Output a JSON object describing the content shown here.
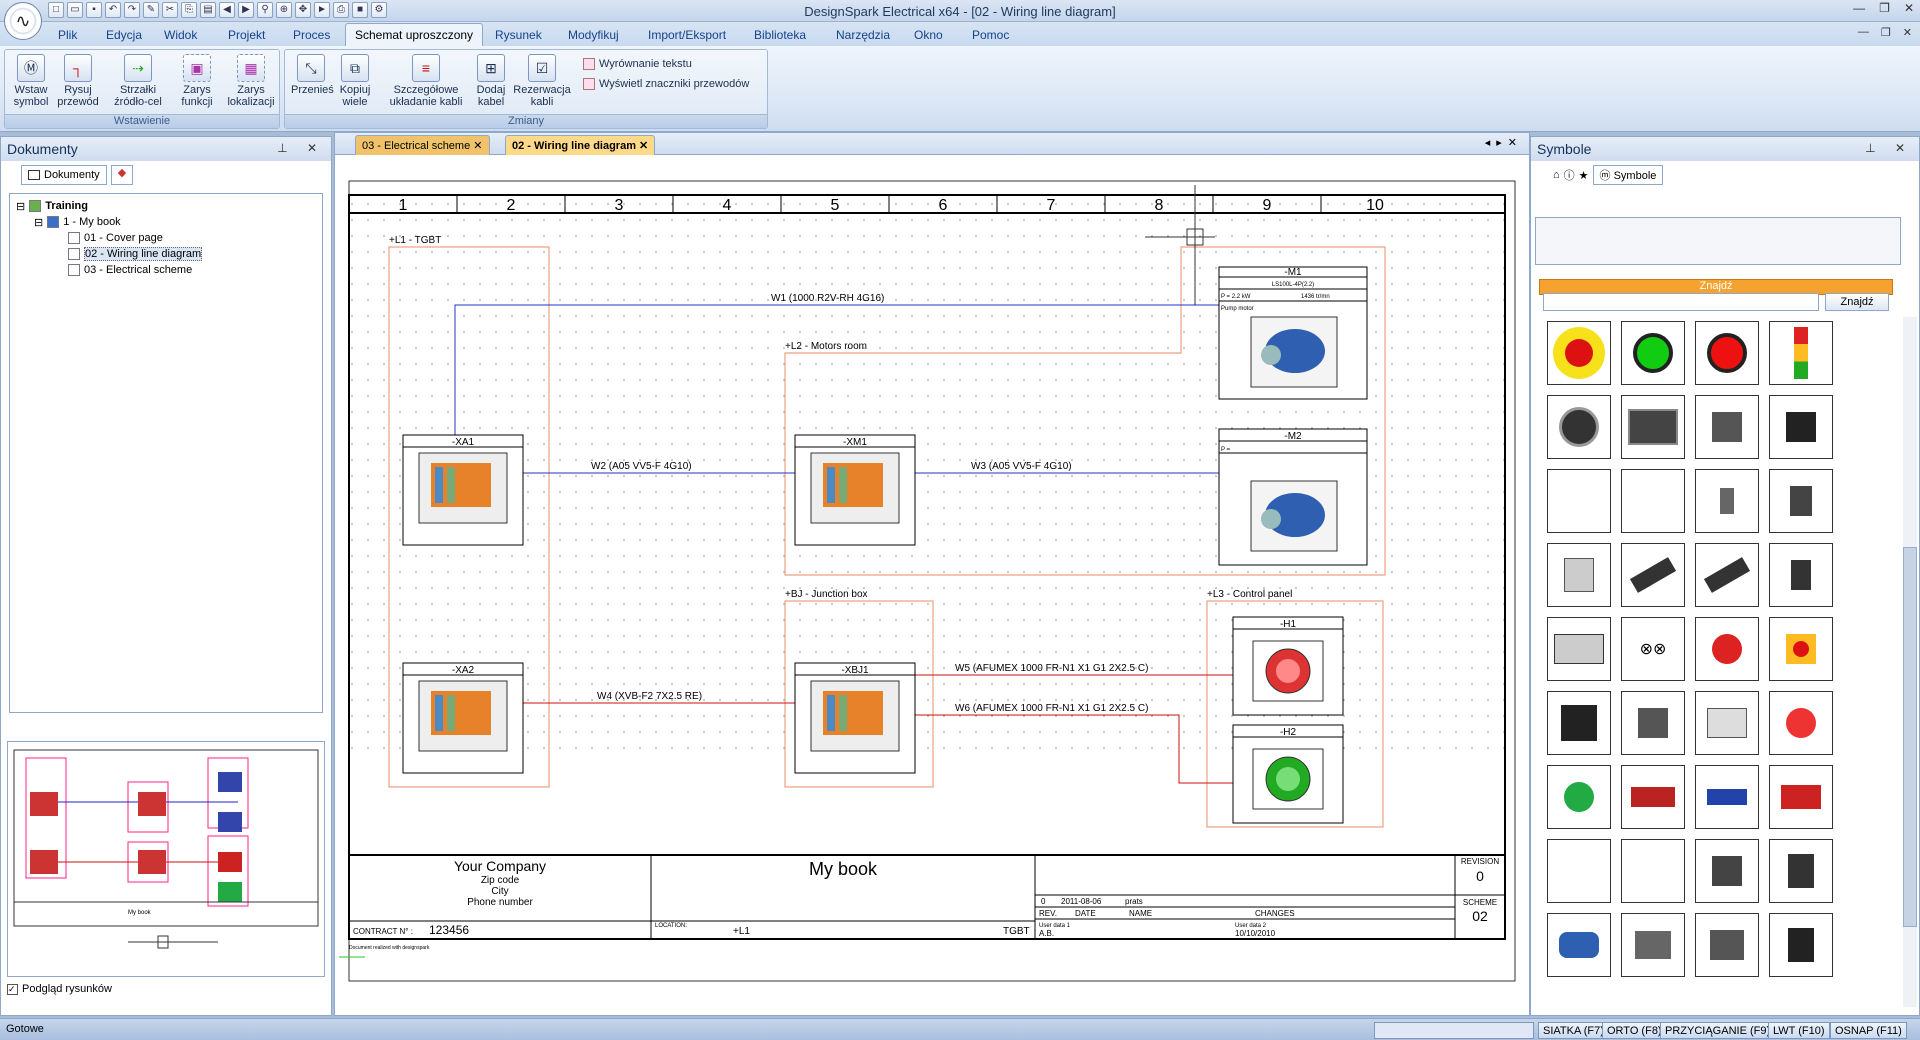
{
  "window": {
    "title": "DesignSpark Electrical x64 - [02 - Wiring line diagram]",
    "logo_glyph": "∿"
  },
  "menu": [
    "Plik",
    "Edycja",
    "Widok",
    "Projekt",
    "Proces",
    "Schemat uproszczony",
    "Rysunek",
    "Modyfikuj",
    "Import/Eksport",
    "Biblioteka",
    "Narzędzia",
    "Okno",
    "Pomoc"
  ],
  "ribbon": {
    "insert_group": "Wstawienie",
    "changes_group": "Zmiany",
    "buttons": {
      "insert_symbol": "Wstaw symbol",
      "draw_wire": "Rysuj przewód",
      "arrows": "Strzałki źródło-cel",
      "function_outline": "Zarys funkcji",
      "location_outline": "Zarys lokalizacji",
      "move": "Przenieś",
      "copy_many": "Kopiuj wiele",
      "cable_layout": "Szczegółowe układanie kabli",
      "add_cable": "Dodaj kabel",
      "cable_reservation": "Rezerwacja kabli",
      "align_text": "Wyrównanie tekstu",
      "show_wire_markers": "Wyświetl znaczniki przewodów"
    }
  },
  "documents_panel": {
    "title": "Dokumenty",
    "tab": "Dokumenty",
    "tree": {
      "root": "Training",
      "book": "1 - My book",
      "pages": [
        "01 - Cover page",
        "02 - Wiring line diagram",
        "03 - Electrical scheme"
      ]
    },
    "preview_checkbox": "Podgląd rysunków",
    "preview_book_label": "My book"
  },
  "doc_tabs": [
    "03 - Electrical scheme",
    "02 - Wiring line diagram"
  ],
  "drawing": {
    "columns": [
      "1",
      "2",
      "3",
      "4",
      "5",
      "6",
      "7",
      "8",
      "9",
      "10"
    ],
    "locations": {
      "l1": "+L1 - TGBT",
      "l2": "+L2 - Motors room",
      "bj": "+BJ - Junction box",
      "l3": "+L3 - Control panel"
    },
    "components": {
      "xa1": "-XA1",
      "xa2": "-XA2",
      "xm1": "-XM1",
      "xbj1": "-XBJ1",
      "m1": "-M1",
      "m2": "-M2",
      "h1": "-H1",
      "h2": "-H2"
    },
    "m1_details": {
      "ref": "LS100L-4P(2.2)",
      "power": "P =  2.2 kW",
      "speed": "1436 tr/mn",
      "desc": "Pump motor"
    },
    "m2_power": "P =",
    "wires": {
      "w1": "W1 (1000 R2V-RH 4G16)",
      "w2": "W2 (A05 VV5-F 4G10)",
      "w3": "W3 (A05 VV5-F 4G10)",
      "w4": "W4 (XVB-F2 7X2.5 RE)",
      "w5": "W5 (AFUMEX 1000 FR-N1 X1 G1 2X2.5 C)",
      "w6": "W6 (AFUMEX 1000 FR-N1 X1 G1 2X2.5 C)"
    },
    "title_block": {
      "company": "Your Company",
      "zip": "Zip code",
      "city": "City",
      "phone": "Phone number",
      "book": "My book",
      "contract_label": "CONTRACT N° :",
      "contract": "123456",
      "location_label": "LOCATION:",
      "location": "+L1",
      "location_name": "TGBT",
      "rev_row": [
        "0",
        "2011-08-06",
        "prats"
      ],
      "rev_headers": [
        "REV.",
        "DATE",
        "NAME",
        "CHANGES"
      ],
      "user_data_1": "User data 1",
      "user_data_1_val": "A.B.",
      "user_data_2": "User data 2",
      "user_data_2_val": "10/10/2010",
      "revision_label": "REVISION",
      "revision": "0",
      "scheme_label": "SCHEME",
      "scheme": "02",
      "footer": "Document realized with designspark"
    }
  },
  "symbols_panel": {
    "title": "Symbole",
    "tab": "Symbole",
    "find_header": "Znajdź",
    "find_button": "Znajdź",
    "find_value": ""
  },
  "status": {
    "ready": "Gotowe",
    "toggles": [
      "SIATKA (F7)",
      "ORTO (F8)",
      "PRZYCIĄGANIE (F9)",
      "LWT (F10)",
      "OSNAP (F11)"
    ]
  },
  "colors": {
    "blue_wire": "#2233cc",
    "red_wire": "#cc1111",
    "outline": "#f0a080"
  }
}
